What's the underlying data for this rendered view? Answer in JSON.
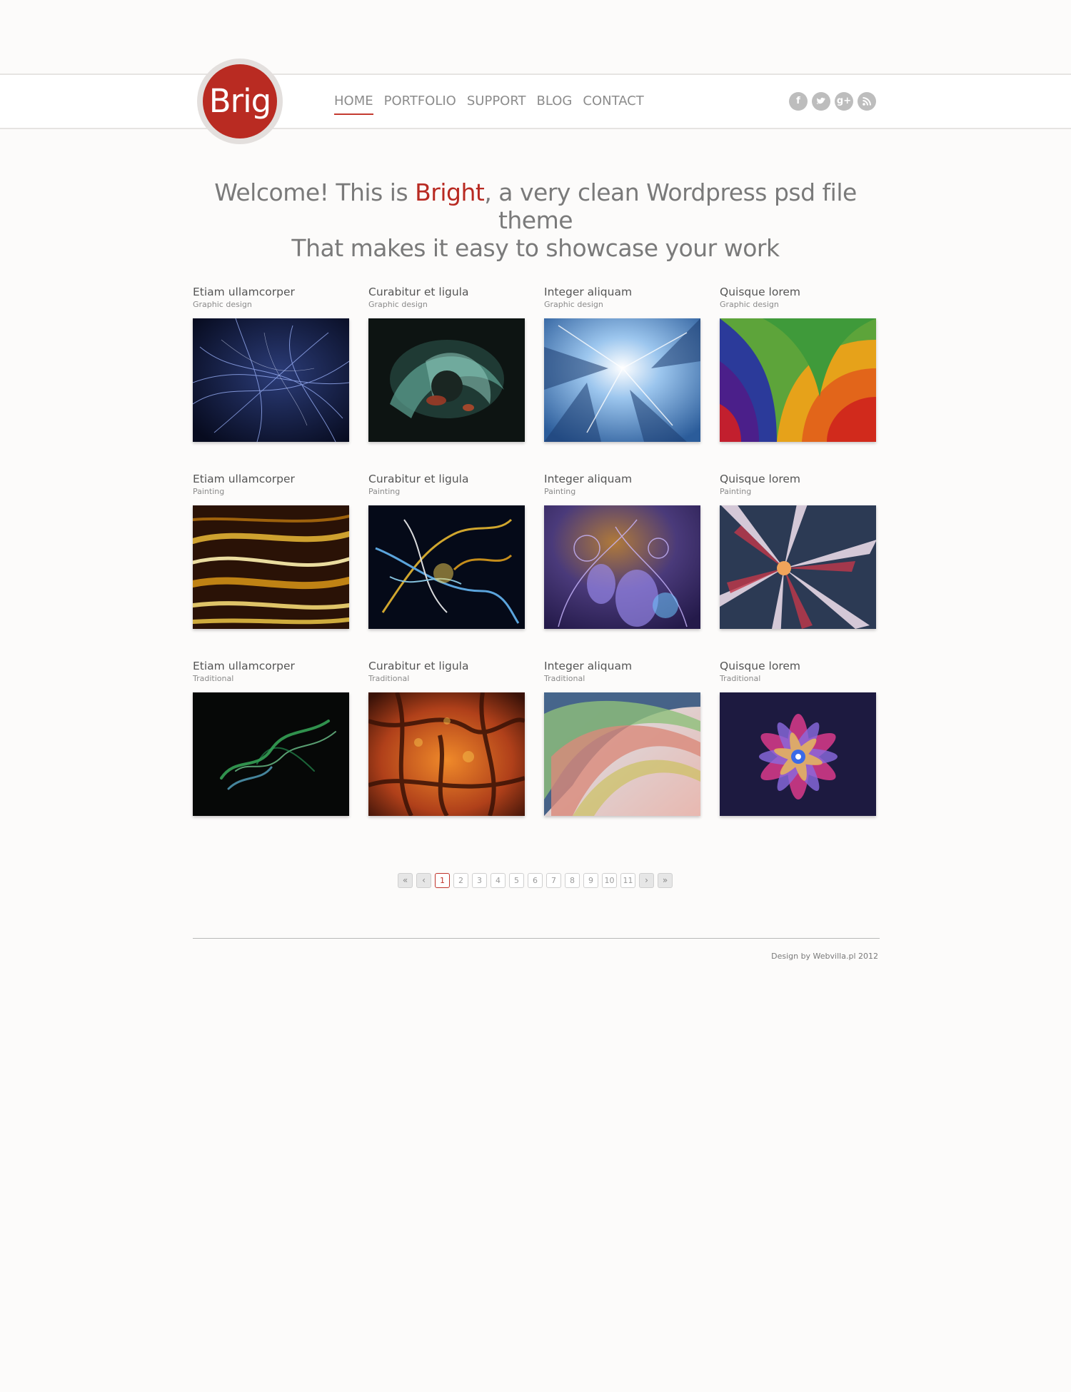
{
  "logo": {
    "text": "Brig"
  },
  "nav": {
    "items": [
      {
        "label": "HOME",
        "active": true
      },
      {
        "label": "PORTFOLIO",
        "active": false
      },
      {
        "label": "SUPPORT",
        "active": false
      },
      {
        "label": "BLOG",
        "active": false
      },
      {
        "label": "CONTACT",
        "active": false
      }
    ]
  },
  "social": {
    "facebook": "f",
    "twitter": "t",
    "googleplus": "g+",
    "rss": "r"
  },
  "welcome": {
    "prefix": "Welcome! This is ",
    "brand": "Bright",
    "suffix": ", a very clean Wordpress psd file theme",
    "line2": "That makes it easy to showcase your work"
  },
  "portfolio": [
    {
      "title": "Etiam ullamcorper",
      "category": "Graphic design",
      "image": "blue-fractal-strands"
    },
    {
      "title": "Curabitur et ligula",
      "category": "Graphic design",
      "image": "dark-liquid-metal"
    },
    {
      "title": "Integer aliquam",
      "category": "Graphic design",
      "image": "light-blue-crystal-burst"
    },
    {
      "title": "Quisque lorem",
      "category": "Graphic design",
      "image": "rainbow-paper-spiral"
    },
    {
      "title": "Etiam ullamcorper",
      "category": "Painting",
      "image": "golden-light-streaks"
    },
    {
      "title": "Curabitur et ligula",
      "category": "Painting",
      "image": "blue-gold-energy"
    },
    {
      "title": "Integer aliquam",
      "category": "Painting",
      "image": "purple-fractal-bloom"
    },
    {
      "title": "Quisque lorem",
      "category": "Painting",
      "image": "star-flower-fractal"
    },
    {
      "title": "Etiam ullamcorper",
      "category": "Traditional",
      "image": "green-smoke"
    },
    {
      "title": "Curabitur et ligula",
      "category": "Traditional",
      "image": "orange-fractal-web"
    },
    {
      "title": "Integer aliquam",
      "category": "Traditional",
      "image": "pastel-waves"
    },
    {
      "title": "Quisque lorem",
      "category": "Traditional",
      "image": "colorful-petal-flower"
    }
  ],
  "pagination": {
    "first": "«",
    "prev": "‹",
    "pages": [
      "1",
      "2",
      "3",
      "4",
      "5",
      "6",
      "7",
      "8",
      "9",
      "10",
      "11"
    ],
    "current": "1",
    "next": "›",
    "last": "»"
  },
  "footer": {
    "credit": "Design by Webvilla.pl 2012"
  }
}
